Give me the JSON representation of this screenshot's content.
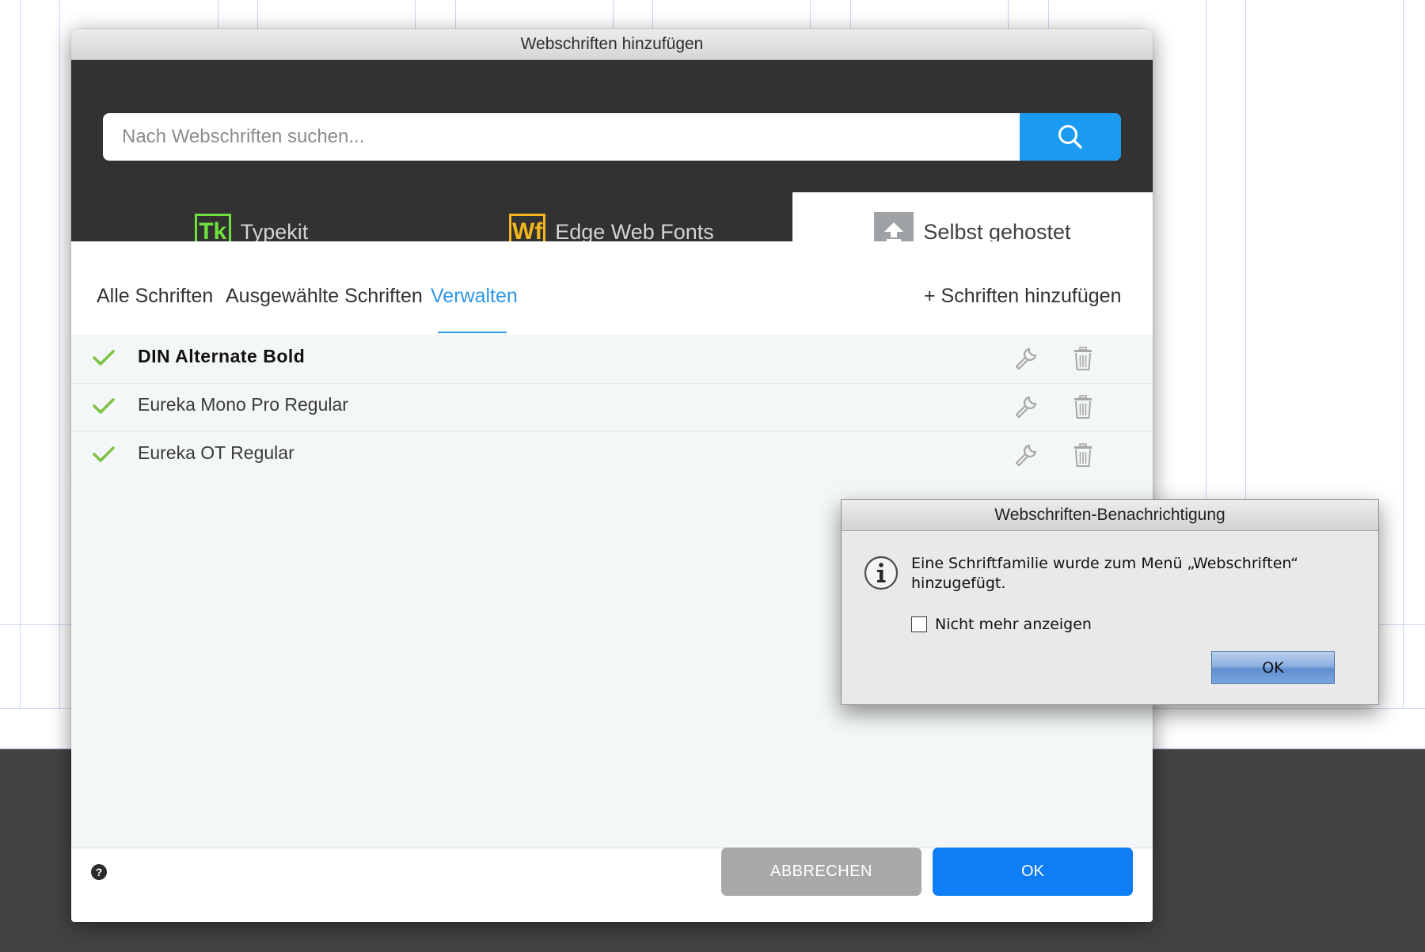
{
  "main_dialog": {
    "title": "Webschriften hinzufügen",
    "search": {
      "placeholder": "Nach Webschriften suchen...",
      "value": "",
      "button_icon": "search-icon"
    },
    "source_tabs": [
      {
        "badge": "Tk",
        "label": "Typekit",
        "badge_color": "#6ee23b",
        "active": false
      },
      {
        "badge": "Wf",
        "label": "Edge Web Fonts",
        "badge_color": "#f2b71c",
        "active": false
      },
      {
        "badge_icon": "upload-icon",
        "label": "Selbst gehostet",
        "active": true
      }
    ],
    "sub_nav": {
      "items": [
        {
          "label": "Alle Schriften",
          "active": false
        },
        {
          "label": "Ausgewählte Schriften",
          "active": false
        },
        {
          "label": "Verwalten",
          "active": true
        }
      ],
      "add_link": "+ Schriften hinzufügen"
    },
    "fonts": [
      {
        "name": "DIN Alternate Bold",
        "checked": true
      },
      {
        "name": "Eureka Mono Pro Regular",
        "checked": true
      },
      {
        "name": "Eureka OT Regular",
        "checked": true
      }
    ],
    "footer": {
      "help_icon": "help-icon",
      "cancel_label": "ABBRECHEN",
      "ok_label": "OK"
    }
  },
  "alert_dialog": {
    "title": "Webschriften-Benachrichtigung",
    "icon": "info-icon",
    "message": "Eine Schriftfamilie wurde zum Menü „Webschriften“ hinzugefügt.",
    "checkbox_label": "Nicht mehr anzeigen",
    "checkbox_checked": false,
    "ok_label": "OK"
  },
  "colors": {
    "accent_blue": "#1a9af1",
    "ok_blue": "#0f7df3",
    "check_green": "#7dc242",
    "header_dark": "#323232"
  }
}
